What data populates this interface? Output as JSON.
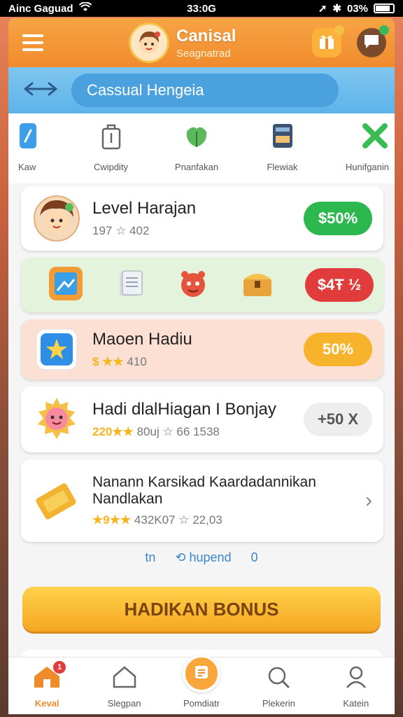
{
  "status_bar": {
    "carrier": "Ainc Gaguad",
    "time": "33:0G",
    "battery": "03%"
  },
  "header": {
    "title": "Canisal",
    "subtitle": "Seagnatrad"
  },
  "search": {
    "placeholder": "Cassual Hengeia"
  },
  "categories": [
    {
      "label": "Kaw",
      "icon": "pencil-icon"
    },
    {
      "label": "Cwipdity",
      "icon": "bag-icon"
    },
    {
      "label": "Pnanfakan",
      "icon": "leaf-icon"
    },
    {
      "label": "Flewiak",
      "icon": "card-icon"
    },
    {
      "label": "Hunifganin",
      "icon": "x-icon"
    }
  ],
  "cards": [
    {
      "title": "Level Harajan",
      "meta": "197 ☆ 402",
      "pill": "$50%",
      "pill_color": "#2cb84f"
    },
    {
      "pill": "$4Ŧ ½",
      "pill_color": "#e23b3b"
    },
    {
      "title": "Maoen Hadiu",
      "stars": "$ ★★",
      "meta": "410",
      "pill": "50%",
      "pill_color": "#f7b32b"
    },
    {
      "title": "Hadi dlalHiagan I Bonjay",
      "stars": "220★★",
      "meta": "80uj ☆ 66 1538",
      "pill": "+50 X",
      "pill_color": "#eeeeee"
    },
    {
      "title_line1": "Nanann Karsikad Kaardadannikan",
      "title_line2": "Nandlakan",
      "stars": "★9★★",
      "meta": "432K07 ☆ 22,03"
    }
  ],
  "links": {
    "left": "tn",
    "middle": "hupend",
    "right": "0"
  },
  "bonus_button": "HADIKAN BONUS",
  "tabbar": [
    {
      "label": "Keval",
      "badge": "1"
    },
    {
      "label": "Slegpan"
    },
    {
      "label": "Pomdiatr"
    },
    {
      "label": "Plekerin"
    },
    {
      "label": "Katein"
    }
  ],
  "colors": {
    "header_orange": "#f08b2c",
    "search_blue": "#5db3e9",
    "accent_green": "#2cb84f",
    "accent_red": "#e23b3b",
    "accent_yellow": "#f7b32b"
  }
}
